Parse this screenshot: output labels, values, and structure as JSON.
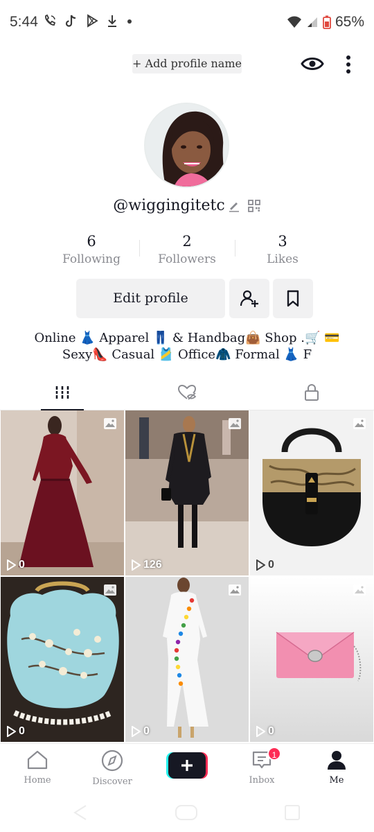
{
  "status_bar": {
    "time": "5:44",
    "battery": "65%"
  },
  "header": {
    "add_profile_name": "+ Add profile name"
  },
  "profile": {
    "username": "@wiggingitetc",
    "stats": [
      {
        "value": "6",
        "label": "Following"
      },
      {
        "value": "2",
        "label": "Followers"
      },
      {
        "value": "3",
        "label": "Likes"
      }
    ],
    "edit_profile_label": "Edit profile",
    "bio_line1": "Online 👗 Apparel 👖 & Handbag👜 Shop .🛒 💳",
    "bio_line2": "Sexy👠 Casual 🎽 Office🧥 Formal 👗 F"
  },
  "tabs": [
    {
      "icon": "grid-icon",
      "active": true
    },
    {
      "icon": "liked-hidden-icon",
      "active": false
    },
    {
      "icon": "lock-icon",
      "active": false
    }
  ],
  "videos": [
    {
      "views": "0",
      "type": "photo",
      "theme": "burgundy-dress"
    },
    {
      "views": "126",
      "type": "photo",
      "theme": "runway-coat"
    },
    {
      "views": "0",
      "type": "photo",
      "theme": "black-gold-bag"
    },
    {
      "views": "0",
      "type": "photo",
      "theme": "blue-floral-bag"
    },
    {
      "views": "0",
      "type": "photo",
      "theme": "white-button-dress"
    },
    {
      "views": "0",
      "type": "photo",
      "theme": "pink-clutch"
    }
  ],
  "bottom_nav": {
    "home": "Home",
    "discover": "Discover",
    "inbox": "Inbox",
    "inbox_badge": "1",
    "me": "Me"
  },
  "colors": {
    "accent_red": "#fe2c55",
    "accent_cyan": "#25f4ee",
    "text_primary": "#161823",
    "text_secondary": "#8a8b91"
  }
}
